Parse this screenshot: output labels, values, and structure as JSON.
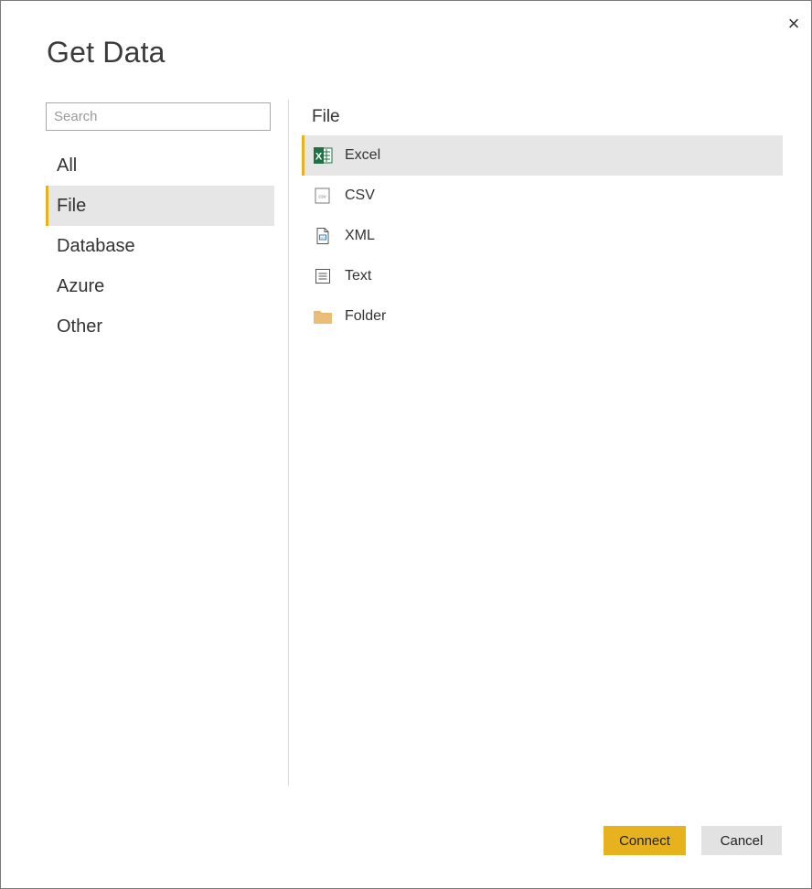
{
  "dialog": {
    "title": "Get Data",
    "close_glyph": "×"
  },
  "search": {
    "placeholder": "Search",
    "value": ""
  },
  "categories": [
    {
      "label": "All",
      "selected": false
    },
    {
      "label": "File",
      "selected": true
    },
    {
      "label": "Database",
      "selected": false
    },
    {
      "label": "Azure",
      "selected": false
    },
    {
      "label": "Other",
      "selected": false
    }
  ],
  "section": {
    "title": "File"
  },
  "sources": [
    {
      "label": "Excel",
      "icon": "excel-icon",
      "selected": true
    },
    {
      "label": "CSV",
      "icon": "csv-icon",
      "selected": false
    },
    {
      "label": "XML",
      "icon": "xml-icon",
      "selected": false
    },
    {
      "label": "Text",
      "icon": "text-file-icon",
      "selected": false
    },
    {
      "label": "Folder",
      "icon": "folder-icon",
      "selected": false
    }
  ],
  "buttons": {
    "connect": "Connect",
    "cancel": "Cancel"
  },
  "colors": {
    "accent": "#e6b31e",
    "selection": "#e6e6e6",
    "excel_green": "#1e7145",
    "folder": "#e8b870"
  }
}
